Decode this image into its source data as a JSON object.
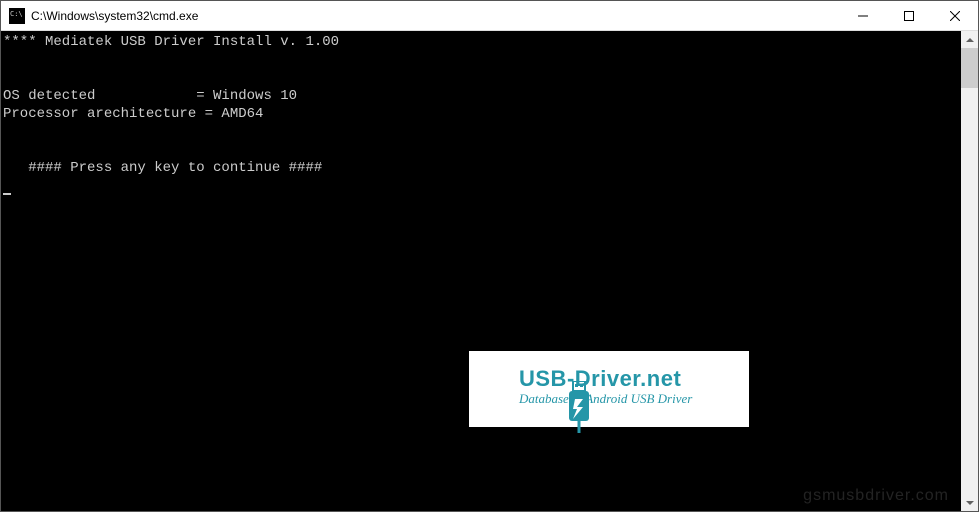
{
  "window": {
    "title": "C:\\Windows\\system32\\cmd.exe"
  },
  "console": {
    "line1": "**** Mediatek USB Driver Install v. 1.00",
    "line2": "",
    "line3": "",
    "line4": "OS detected            = Windows 10",
    "line5": "Processor arechitecture = AMD64",
    "line6": "",
    "line7": "",
    "line8": "   #### Press any key to continue ####"
  },
  "watermark": {
    "logo_main": "USB-Driver.net",
    "logo_sub": "Database of Android USB Driver",
    "bottom_text": "gsmusbdriver.com"
  }
}
